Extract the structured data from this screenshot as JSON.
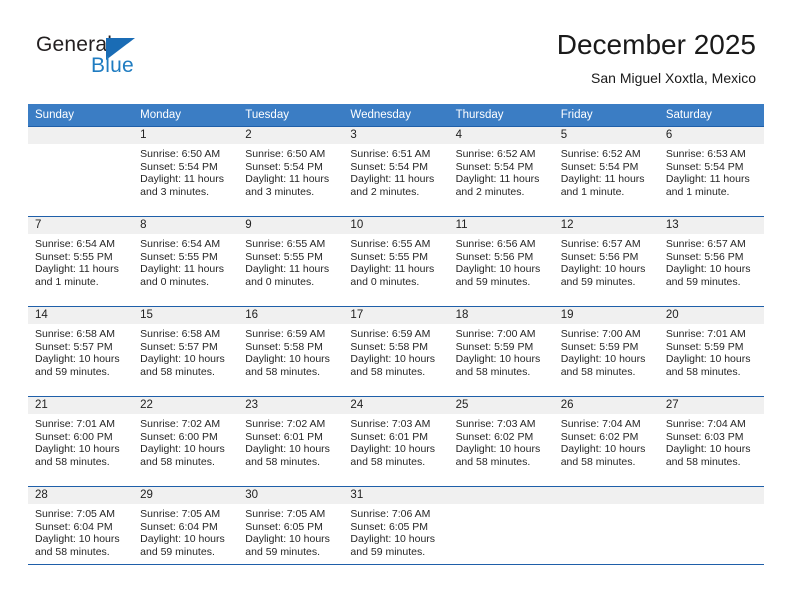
{
  "brand": {
    "name_part1": "General",
    "name_part2": "Blue",
    "logo_icon": "blue-triangle-icon",
    "accent_color": "#1a6cb5"
  },
  "header": {
    "title": "December 2025",
    "subtitle": "San Miguel Xoxtla, Mexico"
  },
  "theme": {
    "header_bg": "#3b7dc4",
    "header_text": "#ffffff",
    "week_rule": "#1f5fa9",
    "daynum_bg": "#f0f0f0"
  },
  "weekdays": [
    "Sunday",
    "Monday",
    "Tuesday",
    "Wednesday",
    "Thursday",
    "Friday",
    "Saturday"
  ],
  "weeks": [
    [
      {
        "day": "",
        "lines": [
          "",
          "",
          "",
          ""
        ]
      },
      {
        "day": "1",
        "lines": [
          "Sunrise: 6:50 AM",
          "Sunset: 5:54 PM",
          "Daylight: 11 hours",
          "and 3 minutes."
        ]
      },
      {
        "day": "2",
        "lines": [
          "Sunrise: 6:50 AM",
          "Sunset: 5:54 PM",
          "Daylight: 11 hours",
          "and 3 minutes."
        ]
      },
      {
        "day": "3",
        "lines": [
          "Sunrise: 6:51 AM",
          "Sunset: 5:54 PM",
          "Daylight: 11 hours",
          "and 2 minutes."
        ]
      },
      {
        "day": "4",
        "lines": [
          "Sunrise: 6:52 AM",
          "Sunset: 5:54 PM",
          "Daylight: 11 hours",
          "and 2 minutes."
        ]
      },
      {
        "day": "5",
        "lines": [
          "Sunrise: 6:52 AM",
          "Sunset: 5:54 PM",
          "Daylight: 11 hours",
          "and 1 minute."
        ]
      },
      {
        "day": "6",
        "lines": [
          "Sunrise: 6:53 AM",
          "Sunset: 5:54 PM",
          "Daylight: 11 hours",
          "and 1 minute."
        ]
      }
    ],
    [
      {
        "day": "7",
        "lines": [
          "Sunrise: 6:54 AM",
          "Sunset: 5:55 PM",
          "Daylight: 11 hours",
          "and 1 minute."
        ]
      },
      {
        "day": "8",
        "lines": [
          "Sunrise: 6:54 AM",
          "Sunset: 5:55 PM",
          "Daylight: 11 hours",
          "and 0 minutes."
        ]
      },
      {
        "day": "9",
        "lines": [
          "Sunrise: 6:55 AM",
          "Sunset: 5:55 PM",
          "Daylight: 11 hours",
          "and 0 minutes."
        ]
      },
      {
        "day": "10",
        "lines": [
          "Sunrise: 6:55 AM",
          "Sunset: 5:55 PM",
          "Daylight: 11 hours",
          "and 0 minutes."
        ]
      },
      {
        "day": "11",
        "lines": [
          "Sunrise: 6:56 AM",
          "Sunset: 5:56 PM",
          "Daylight: 10 hours",
          "and 59 minutes."
        ]
      },
      {
        "day": "12",
        "lines": [
          "Sunrise: 6:57 AM",
          "Sunset: 5:56 PM",
          "Daylight: 10 hours",
          "and 59 minutes."
        ]
      },
      {
        "day": "13",
        "lines": [
          "Sunrise: 6:57 AM",
          "Sunset: 5:56 PM",
          "Daylight: 10 hours",
          "and 59 minutes."
        ]
      }
    ],
    [
      {
        "day": "14",
        "lines": [
          "Sunrise: 6:58 AM",
          "Sunset: 5:57 PM",
          "Daylight: 10 hours",
          "and 59 minutes."
        ]
      },
      {
        "day": "15",
        "lines": [
          "Sunrise: 6:58 AM",
          "Sunset: 5:57 PM",
          "Daylight: 10 hours",
          "and 58 minutes."
        ]
      },
      {
        "day": "16",
        "lines": [
          "Sunrise: 6:59 AM",
          "Sunset: 5:58 PM",
          "Daylight: 10 hours",
          "and 58 minutes."
        ]
      },
      {
        "day": "17",
        "lines": [
          "Sunrise: 6:59 AM",
          "Sunset: 5:58 PM",
          "Daylight: 10 hours",
          "and 58 minutes."
        ]
      },
      {
        "day": "18",
        "lines": [
          "Sunrise: 7:00 AM",
          "Sunset: 5:59 PM",
          "Daylight: 10 hours",
          "and 58 minutes."
        ]
      },
      {
        "day": "19",
        "lines": [
          "Sunrise: 7:00 AM",
          "Sunset: 5:59 PM",
          "Daylight: 10 hours",
          "and 58 minutes."
        ]
      },
      {
        "day": "20",
        "lines": [
          "Sunrise: 7:01 AM",
          "Sunset: 5:59 PM",
          "Daylight: 10 hours",
          "and 58 minutes."
        ]
      }
    ],
    [
      {
        "day": "21",
        "lines": [
          "Sunrise: 7:01 AM",
          "Sunset: 6:00 PM",
          "Daylight: 10 hours",
          "and 58 minutes."
        ]
      },
      {
        "day": "22",
        "lines": [
          "Sunrise: 7:02 AM",
          "Sunset: 6:00 PM",
          "Daylight: 10 hours",
          "and 58 minutes."
        ]
      },
      {
        "day": "23",
        "lines": [
          "Sunrise: 7:02 AM",
          "Sunset: 6:01 PM",
          "Daylight: 10 hours",
          "and 58 minutes."
        ]
      },
      {
        "day": "24",
        "lines": [
          "Sunrise: 7:03 AM",
          "Sunset: 6:01 PM",
          "Daylight: 10 hours",
          "and 58 minutes."
        ]
      },
      {
        "day": "25",
        "lines": [
          "Sunrise: 7:03 AM",
          "Sunset: 6:02 PM",
          "Daylight: 10 hours",
          "and 58 minutes."
        ]
      },
      {
        "day": "26",
        "lines": [
          "Sunrise: 7:04 AM",
          "Sunset: 6:02 PM",
          "Daylight: 10 hours",
          "and 58 minutes."
        ]
      },
      {
        "day": "27",
        "lines": [
          "Sunrise: 7:04 AM",
          "Sunset: 6:03 PM",
          "Daylight: 10 hours",
          "and 58 minutes."
        ]
      }
    ],
    [
      {
        "day": "28",
        "lines": [
          "Sunrise: 7:05 AM",
          "Sunset: 6:04 PM",
          "Daylight: 10 hours",
          "and 58 minutes."
        ]
      },
      {
        "day": "29",
        "lines": [
          "Sunrise: 7:05 AM",
          "Sunset: 6:04 PM",
          "Daylight: 10 hours",
          "and 59 minutes."
        ]
      },
      {
        "day": "30",
        "lines": [
          "Sunrise: 7:05 AM",
          "Sunset: 6:05 PM",
          "Daylight: 10 hours",
          "and 59 minutes."
        ]
      },
      {
        "day": "31",
        "lines": [
          "Sunrise: 7:06 AM",
          "Sunset: 6:05 PM",
          "Daylight: 10 hours",
          "and 59 minutes."
        ]
      },
      {
        "day": "",
        "lines": [
          "",
          "",
          "",
          ""
        ]
      },
      {
        "day": "",
        "lines": [
          "",
          "",
          "",
          ""
        ]
      },
      {
        "day": "",
        "lines": [
          "",
          "",
          "",
          ""
        ]
      }
    ]
  ]
}
